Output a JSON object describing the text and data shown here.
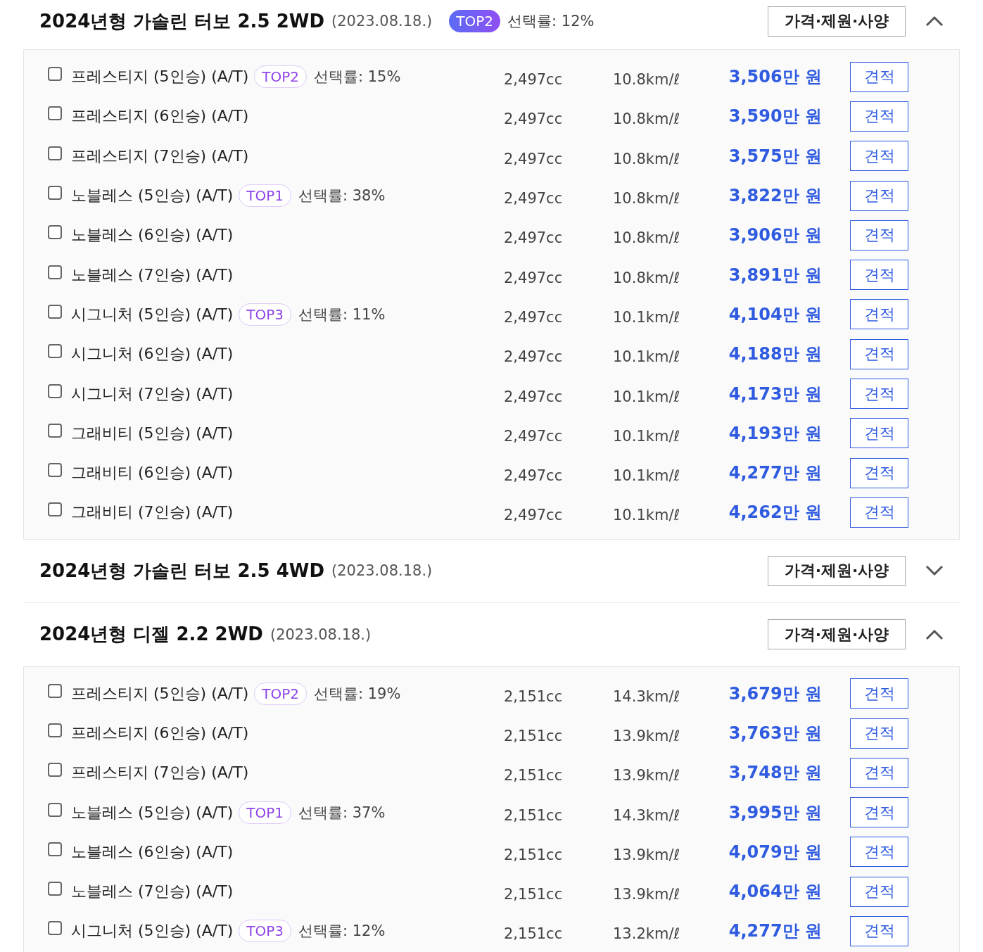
{
  "sections": [
    {
      "title": "2024년형 가솔린 터보 2.5 2WD",
      "date": "(2023.08.18.)",
      "badge": "TOP2",
      "rate": "선택률: 12%",
      "specs_button": "가격·제원·사양",
      "expanded": true,
      "trims": [
        {
          "name": "프레스티지 (5인승) (A/T)",
          "checked": false,
          "badge": "TOP2",
          "rate": "선택률: 15%",
          "displacement": "2,497cc",
          "efficiency": "10.8km/ℓ",
          "price": "3,506만 원",
          "quote": "견적"
        },
        {
          "name": "프레스티지 (6인승) (A/T)",
          "checked": false,
          "displacement": "2,497cc",
          "efficiency": "10.8km/ℓ",
          "price": "3,590만 원",
          "quote": "견적"
        },
        {
          "name": "프레스티지 (7인승) (A/T)",
          "checked": false,
          "displacement": "2,497cc",
          "efficiency": "10.8km/ℓ",
          "price": "3,575만 원",
          "quote": "견적"
        },
        {
          "name": "노블레스 (5인승) (A/T)",
          "checked": false,
          "badge": "TOP1",
          "rate": "선택률: 38%",
          "displacement": "2,497cc",
          "efficiency": "10.8km/ℓ",
          "price": "3,822만 원",
          "quote": "견적"
        },
        {
          "name": "노블레스 (6인승) (A/T)",
          "checked": false,
          "displacement": "2,497cc",
          "efficiency": "10.8km/ℓ",
          "price": "3,906만 원",
          "quote": "견적"
        },
        {
          "name": "노블레스 (7인승) (A/T)",
          "checked": false,
          "displacement": "2,497cc",
          "efficiency": "10.8km/ℓ",
          "price": "3,891만 원",
          "quote": "견적"
        },
        {
          "name": "시그니처 (5인승) (A/T)",
          "checked": false,
          "badge": "TOP3",
          "rate": "선택률: 11%",
          "displacement": "2,497cc",
          "efficiency": "10.1km/ℓ",
          "price": "4,104만 원",
          "quote": "견적"
        },
        {
          "name": "시그니처 (6인승) (A/T)",
          "checked": false,
          "displacement": "2,497cc",
          "efficiency": "10.1km/ℓ",
          "price": "4,188만 원",
          "quote": "견적"
        },
        {
          "name": "시그니처 (7인승) (A/T)",
          "checked": false,
          "displacement": "2,497cc",
          "efficiency": "10.1km/ℓ",
          "price": "4,173만 원",
          "quote": "견적"
        },
        {
          "name": "그래비티 (5인승) (A/T)",
          "checked": false,
          "displacement": "2,497cc",
          "efficiency": "10.1km/ℓ",
          "price": "4,193만 원",
          "quote": "견적"
        },
        {
          "name": "그래비티 (6인승) (A/T)",
          "checked": false,
          "displacement": "2,497cc",
          "efficiency": "10.1km/ℓ",
          "price": "4,277만 원",
          "quote": "견적"
        },
        {
          "name": "그래비티 (7인승) (A/T)",
          "checked": false,
          "displacement": "2,497cc",
          "efficiency": "10.1km/ℓ",
          "price": "4,262만 원",
          "quote": "견적"
        }
      ]
    },
    {
      "title": "2024년형 가솔린 터보 2.5 4WD",
      "date": "(2023.08.18.)",
      "specs_button": "가격·제원·사양",
      "expanded": false
    },
    {
      "title": "2024년형 디젤 2.2 2WD",
      "date": "(2023.08.18.)",
      "specs_button": "가격·제원·사양",
      "expanded": true,
      "trims": [
        {
          "name": "프레스티지 (5인승) (A/T)",
          "checked": false,
          "badge": "TOP2",
          "rate": "선택률: 19%",
          "displacement": "2,151cc",
          "efficiency": "14.3km/ℓ",
          "price": "3,679만 원",
          "quote": "견적"
        },
        {
          "name": "프레스티지 (6인승) (A/T)",
          "checked": false,
          "displacement": "2,151cc",
          "efficiency": "13.9km/ℓ",
          "price": "3,763만 원",
          "quote": "견적"
        },
        {
          "name": "프레스티지 (7인승) (A/T)",
          "checked": false,
          "displacement": "2,151cc",
          "efficiency": "13.9km/ℓ",
          "price": "3,748만 원",
          "quote": "견적"
        },
        {
          "name": "노블레스 (5인승) (A/T)",
          "checked": false,
          "badge": "TOP1",
          "rate": "선택률: 37%",
          "displacement": "2,151cc",
          "efficiency": "14.3km/ℓ",
          "price": "3,995만 원",
          "quote": "견적"
        },
        {
          "name": "노블레스 (6인승) (A/T)",
          "checked": false,
          "displacement": "2,151cc",
          "efficiency": "13.9km/ℓ",
          "price": "4,079만 원",
          "quote": "견적"
        },
        {
          "name": "노블레스 (7인승) (A/T)",
          "checked": false,
          "displacement": "2,151cc",
          "efficiency": "13.9km/ℓ",
          "price": "4,064만 원",
          "quote": "견적"
        },
        {
          "name": "시그니처 (5인승) (A/T)",
          "checked": false,
          "badge": "TOP3",
          "rate": "선택률: 12%",
          "displacement": "2,151cc",
          "efficiency": "13.2km/ℓ",
          "price": "4,277만 원",
          "quote": "견적"
        }
      ]
    }
  ]
}
